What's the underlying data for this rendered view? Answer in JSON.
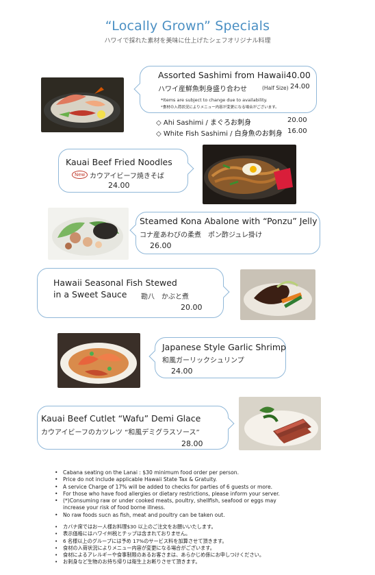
{
  "header": {
    "title": "“Locally Grown” Specials",
    "subtitle": "ハワイで採れた素材を美味に仕上げたシェフオリジナル料理"
  },
  "items": [
    {
      "name": "Assorted Sashimi from Hawaii",
      "price": "40.00",
      "jp": "ハワイ産鮮魚刺身盛り合わせ",
      "half_label": "(Half Size)",
      "half_price": "24.00",
      "note_en": "*Items are subject to change due to availability.",
      "note_jp": "*食材の入荷状況によりメニュー内容が変更になる場合がございます。",
      "subitems": [
        {
          "label": "◇ Ahi Sashimi / まぐろお刺身",
          "price": "20.00"
        },
        {
          "label": "◇ White Fish Sashimi / 白身魚のお刺身",
          "price": "16.00"
        }
      ]
    },
    {
      "name": "Kauai Beef Fried Noodles",
      "badge": "New",
      "jp": "カウアイビーフ焼きそば",
      "price": "24.00"
    },
    {
      "name": "Steamed Kona Abalone  with “Ponzu” Jelly",
      "jp": "コナ産あわびの柔煮　ポン酢ジュレ掛け",
      "price": "26.00"
    },
    {
      "name_line1": "Hawaii Seasonal Fish Stewed",
      "name_line2": "in a Sweet Sauce",
      "jp": "勘八　かぶと煮",
      "price": "20.00"
    },
    {
      "name": "Japanese Style Garlic Shrimp",
      "jp": "和風ガーリックシュリンプ",
      "price": "24.00"
    },
    {
      "name": "Kauai Beef Cutlet  “Wafu” Demi Glace",
      "jp": "カウアイビーフのカツレツ “和風デミグラスソース”",
      "price": "28.00"
    }
  ],
  "notes_en": [
    "Cabana seating on the Lanai : $30 minimum food order per person.",
    "Price do not include applicable Hawaii State Tax & Gratuity.",
    "A service Charge of 17% will be added to checks for parties of 6 guests or more.",
    "For those who have food allergies or dietary restrictions, please inform your server.",
    "(*)Consuming raw or under cooked meats, poultry, shellfish, seafood or eggs may",
    "increase your risk of food borne illness.",
    "No raw foods sucn as fish, meat and poultry can be taken out."
  ],
  "notes_jp": [
    "カバナ席ではお一人様お料理$30 以上のご注文をお願いいたします。",
    "表示価格にはハワイ州税とチップは含まれておりません。",
    "6 名様以上のグループには予め 17%のサービス料を加算させて頂きます。",
    "食材の入荷状況によりメニュー内容が変更になる場合がございます。",
    "食材によるアレルギーや食事制限のあるお客さまは、あらかじめ係にお申しつけください。",
    "お刺身など生物のお持ち帰りは衛生上お断りさせて頂きます。"
  ],
  "colors": {
    "title": "#4a8fc3",
    "bubble_border": "#8fb7d8",
    "badge": "#c0392b"
  }
}
